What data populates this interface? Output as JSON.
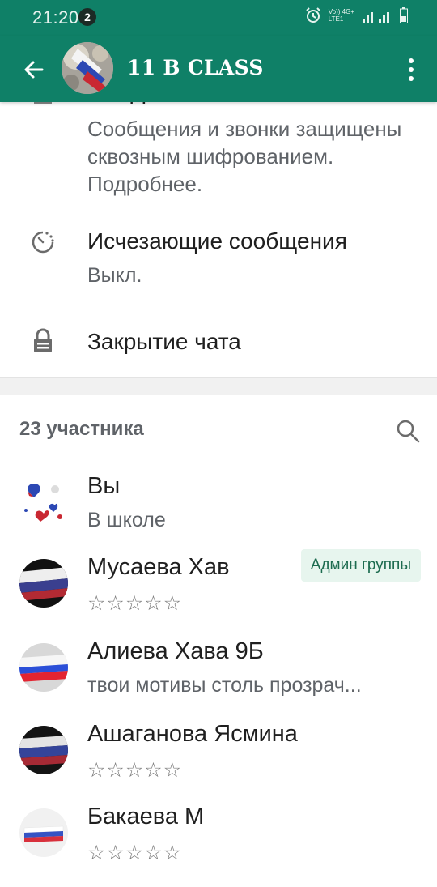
{
  "status_bar": {
    "time": "21:20",
    "notification_count": "2",
    "network_line1": "Vo)) 4G+",
    "network_line2": "LTE1"
  },
  "toolbar": {
    "title": "11 В CLASS"
  },
  "settings": {
    "encryption_title": "Шифрование",
    "encryption_desc": "Сообщения и звонки защищены сквозным шифрованием. Подробнее.",
    "disappearing_title": "Исчезающие сообщения",
    "disappearing_value": "Выкл.",
    "chat_lock_title": "Закрытие чата"
  },
  "participants": {
    "count_label": "23 участника",
    "members": [
      {
        "name": "Вы",
        "status": "В школе",
        "admin": ""
      },
      {
        "name": "Мусаева Хав",
        "status": "☆☆☆☆☆",
        "admin": "Админ группы"
      },
      {
        "name": "Алиева Хава 9Б",
        "status": "твои мотивы столь прозрач...",
        "admin": ""
      },
      {
        "name": "Ашаганова Ясмина",
        "status": "☆☆☆☆☆",
        "admin": ""
      },
      {
        "name": "Бакаева М",
        "status": "☆☆☆☆☆",
        "admin": ""
      }
    ]
  },
  "colors": {
    "header": "#0f8067",
    "admin_badge_bg": "#e7f5ee",
    "admin_badge_text": "#1c6b4f"
  }
}
